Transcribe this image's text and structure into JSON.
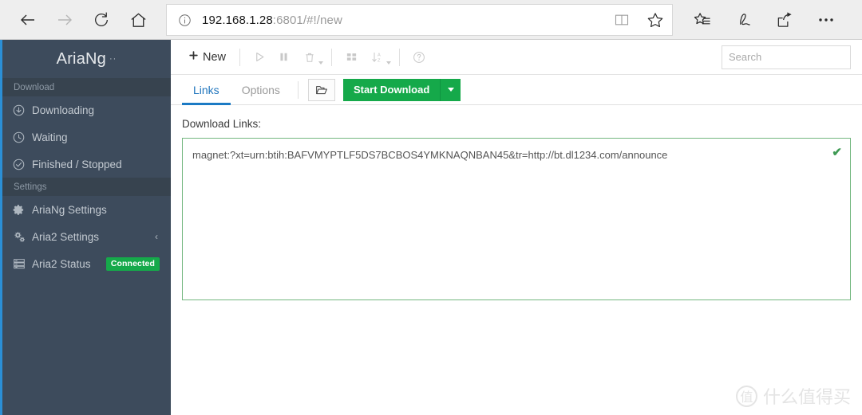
{
  "browser": {
    "back_label": "Back",
    "forward_label": "Forward",
    "refresh_label": "Refresh",
    "home_label": "Home",
    "url_host": "192.168.1.28",
    "url_rest": ":6801/#!/new",
    "info_icon": "info-circle-icon",
    "reading_view_icon": "book-icon",
    "favorite_icon": "star-icon",
    "hub_icon": "star-list-icon",
    "web_note_icon": "pen-icon",
    "share_icon": "share-icon",
    "more_icon": "ellipsis-icon"
  },
  "sidebar": {
    "brand": "AriaNg",
    "brand_sup": "··",
    "sections": [
      {
        "title": "Download",
        "items": [
          {
            "label": "Downloading",
            "icon": "download-circle-icon"
          },
          {
            "label": "Waiting",
            "icon": "clock-icon"
          },
          {
            "label": "Finished / Stopped",
            "icon": "check-circle-icon"
          }
        ]
      },
      {
        "title": "Settings",
        "items": [
          {
            "label": "AriaNg Settings",
            "icon": "gear-icon"
          },
          {
            "label": "Aria2 Settings",
            "icon": "gears-icon",
            "chevron": "‹"
          },
          {
            "label": "Aria2 Status",
            "icon": "server-icon",
            "badge": "Connected"
          }
        ]
      }
    ]
  },
  "toolbar": {
    "new_label": "New",
    "new_icon": "plus-icon",
    "start_icon": "play-icon",
    "pause_icon": "pause-icon",
    "delete_icon": "trash-icon",
    "display_icon": "grid-icon",
    "sort_icon": "sort-az-icon",
    "help_icon": "question-circle-icon"
  },
  "search": {
    "placeholder": "Search",
    "value": "",
    "icon": "search-icon"
  },
  "tabs": [
    {
      "label": "Links",
      "active": true
    },
    {
      "label": "Options",
      "active": false
    }
  ],
  "actions": {
    "folder_icon": "folder-open-icon",
    "start_download_label": "Start Download",
    "dropdown_icon": "caret-down-icon"
  },
  "form": {
    "links_label": "Download Links:",
    "links_value": "magnet:?xt=urn:btih:BAFVMYPTLF5DS7BCBOS4YMKNAQNBAN45&tr=http://bt.dl1234.com/announce",
    "valid_icon": "check-icon"
  },
  "watermark": {
    "mark": "值",
    "text": "什么值得买"
  },
  "colors": {
    "sidebar_bg": "#3d4b5c",
    "sidebar_section_bg": "#37434f",
    "accent_blue": "#1b7ac4",
    "green": "#15a94a",
    "valid_border": "#73b77f"
  }
}
